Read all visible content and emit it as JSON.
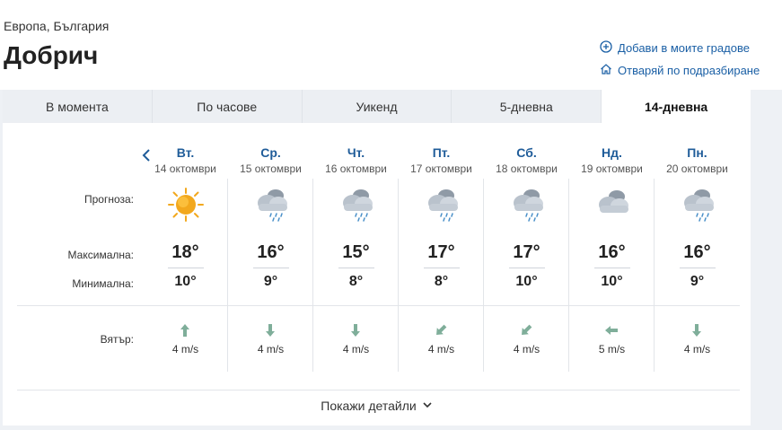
{
  "breadcrumb": "Европа, България",
  "city": "Добрич",
  "actions": {
    "add_city": "Добави в моите градове",
    "open_default": "Отваряй по подразбиране"
  },
  "tabs": [
    {
      "label": "В момента",
      "active": false
    },
    {
      "label": "По часове",
      "active": false
    },
    {
      "label": "Уикенд",
      "active": false
    },
    {
      "label": "5-дневна",
      "active": false
    },
    {
      "label": "14-дневна",
      "active": true
    }
  ],
  "row_labels": {
    "forecast": "Прогноза:",
    "max": "Максимална:",
    "min": "Минимална:",
    "wind": "Вятър:"
  },
  "days": [
    {
      "name": "Вт.",
      "date": "14 октомври",
      "icon": "sun-icon",
      "max": "18°",
      "min": "10°",
      "wind_dir": "north",
      "wind": "4 m/s"
    },
    {
      "name": "Ср.",
      "date": "15 октомври",
      "icon": "cloud-rain-icon",
      "max": "16°",
      "min": "9°",
      "wind_dir": "south",
      "wind": "4 m/s"
    },
    {
      "name": "Чт.",
      "date": "16 октомври",
      "icon": "cloud-rain-icon",
      "max": "15°",
      "min": "8°",
      "wind_dir": "south",
      "wind": "4 m/s"
    },
    {
      "name": "Пт.",
      "date": "17 октомври",
      "icon": "cloud-rain-icon",
      "max": "17°",
      "min": "8°",
      "wind_dir": "southwest",
      "wind": "4 m/s"
    },
    {
      "name": "Сб.",
      "date": "18 октомври",
      "icon": "cloud-rain-icon",
      "max": "17°",
      "min": "10°",
      "wind_dir": "southwest",
      "wind": "4 m/s"
    },
    {
      "name": "Нд.",
      "date": "19 октомври",
      "icon": "cloud-icon",
      "max": "16°",
      "min": "10°",
      "wind_dir": "west",
      "wind": "5 m/s"
    },
    {
      "name": "Пн.",
      "date": "20 октомври",
      "icon": "cloud-rain-icon",
      "max": "16°",
      "min": "9°",
      "wind_dir": "south",
      "wind": "4 m/s"
    }
  ],
  "details_label": "Покажи детайли",
  "colors": {
    "link": "#1a5fa5",
    "day_name": "#1f5c99",
    "sun": "#f2a81d",
    "cloud": "#b9c2cc",
    "wind_arrow": "#7fae9a"
  }
}
